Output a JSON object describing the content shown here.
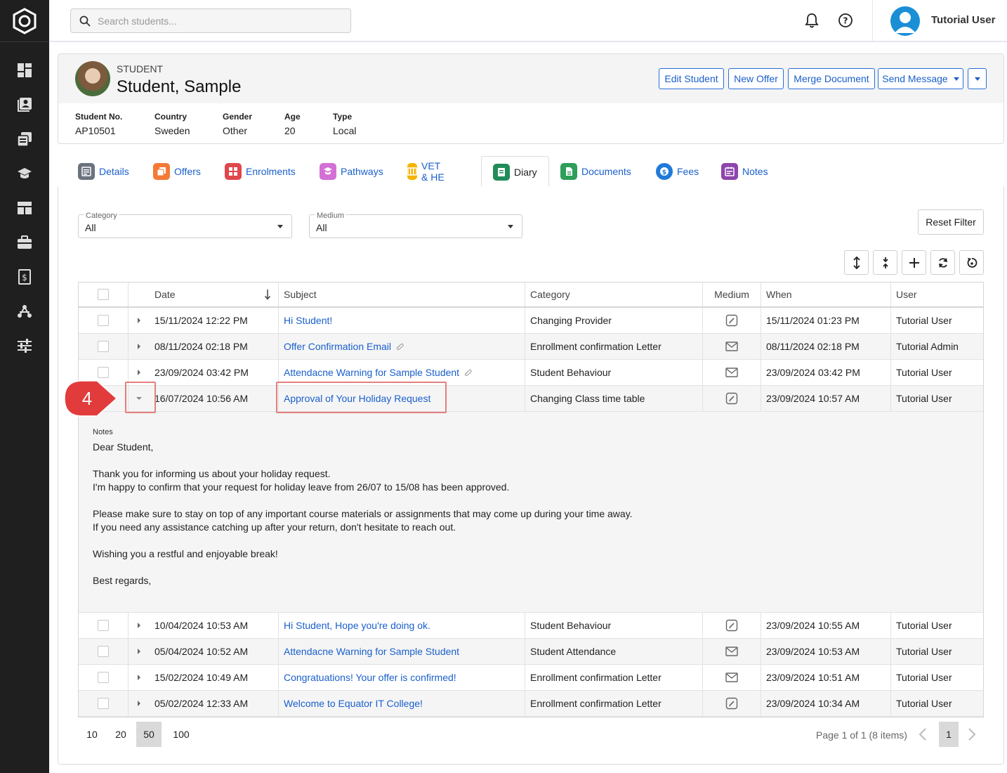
{
  "search": {
    "placeholder": "Search students..."
  },
  "user": {
    "name": "Tutorial User"
  },
  "student": {
    "label": "STUDENT",
    "name": "Student, Sample",
    "info": [
      {
        "label": "Student No.",
        "value": "AP10501"
      },
      {
        "label": "Country",
        "value": "Sweden"
      },
      {
        "label": "Gender",
        "value": "Other"
      },
      {
        "label": "Age",
        "value": "20"
      },
      {
        "label": "Type",
        "value": "Local"
      }
    ],
    "actions": {
      "edit": "Edit Student",
      "new_offer": "New Offer",
      "merge": "Merge Document",
      "send": "Send Message"
    }
  },
  "tabs": [
    {
      "label": "Details",
      "color": "#6b7280"
    },
    {
      "label": "Offers",
      "color": "#f47a36"
    },
    {
      "label": "Enrolments",
      "color": "#e0474c"
    },
    {
      "label": "Pathways",
      "color": "#d36fd6"
    },
    {
      "label": "VET & HE",
      "color": "#f5b300"
    },
    {
      "label": "Diary",
      "color": "#218c5a"
    },
    {
      "label": "Documents",
      "color": "#2e9e5a"
    },
    {
      "label": "Fees",
      "color": "#1f7ad9"
    },
    {
      "label": "Notes",
      "color": "#8e44ad"
    }
  ],
  "filters": {
    "category": {
      "label": "Category",
      "value": "All"
    },
    "medium": {
      "label": "Medium",
      "value": "All"
    },
    "reset": "Reset Filter"
  },
  "grid": {
    "columns": {
      "date": "Date",
      "subject": "Subject",
      "category": "Category",
      "medium": "Medium",
      "when": "When",
      "user": "User"
    },
    "rows": [
      {
        "date": "15/11/2024 12:22 PM",
        "subject": "Hi Student!",
        "category": "Changing Provider",
        "medium": "note",
        "when": "15/11/2024 01:23 PM",
        "user": "Tutorial User",
        "attach": false
      },
      {
        "date": "08/11/2024 02:18 PM",
        "subject": "Offer Confirmation Email",
        "category": "Enrollment confirmation Letter",
        "medium": "email",
        "when": "08/11/2024 02:18 PM",
        "user": "Tutorial Admin",
        "attach": true
      },
      {
        "date": "23/09/2024 03:42 PM",
        "subject": "Attendacne Warning for Sample Student",
        "category": "Student Behaviour",
        "medium": "email",
        "when": "23/09/2024 03:42 PM",
        "user": "Tutorial User",
        "attach": true
      },
      {
        "date": "16/07/2024 10:56 AM",
        "subject": "Approval of Your Holiday Request",
        "category": "Changing Class time table",
        "medium": "note",
        "when": "23/09/2024 10:57 AM",
        "user": "Tutorial User",
        "attach": false
      },
      {
        "date": "10/04/2024 10:53 AM",
        "subject": "Hi Student, Hope you're doing ok.",
        "category": "Student Behaviour",
        "medium": "note",
        "when": "23/09/2024 10:55 AM",
        "user": "Tutorial User",
        "attach": false
      },
      {
        "date": "05/04/2024 10:52 AM",
        "subject": "Attendacne Warning for Sample Student",
        "category": "Student Attendance",
        "medium": "email",
        "when": "23/09/2024 10:53 AM",
        "user": "Tutorial User",
        "attach": false
      },
      {
        "date": "15/02/2024 10:49 AM",
        "subject": "Congratuations! Your offer is confirmed!",
        "category": "Enrollment confirmation Letter",
        "medium": "email",
        "when": "23/09/2024 10:51 AM",
        "user": "Tutorial User",
        "attach": false
      },
      {
        "date": "05/02/2024 12:33 AM",
        "subject": "Welcome to Equator IT College!",
        "category": "Enrollment confirmation Letter",
        "medium": "note",
        "when": "23/09/2024 10:34 AM",
        "user": "Tutorial User",
        "attach": false
      }
    ],
    "detail": {
      "label": "Notes",
      "text": "Dear Student,\n\nThank you for informing us about your holiday request.\nI'm happy to confirm that your request for holiday leave from 26/07 to 15/08 has been approved.\n\nPlease make sure to stay on top of any important course materials or assignments that may come up during your time away.\nIf you need any assistance catching up after your return, don't hesitate to reach out.\n\nWishing you a restful and enjoyable break!\n\nBest regards,"
    }
  },
  "pager": {
    "sizes": [
      "10",
      "20",
      "50",
      "100"
    ],
    "selected": "50",
    "info": "Page 1 of 1 (8 items)",
    "page": "1"
  },
  "annotation": {
    "step": "4"
  }
}
